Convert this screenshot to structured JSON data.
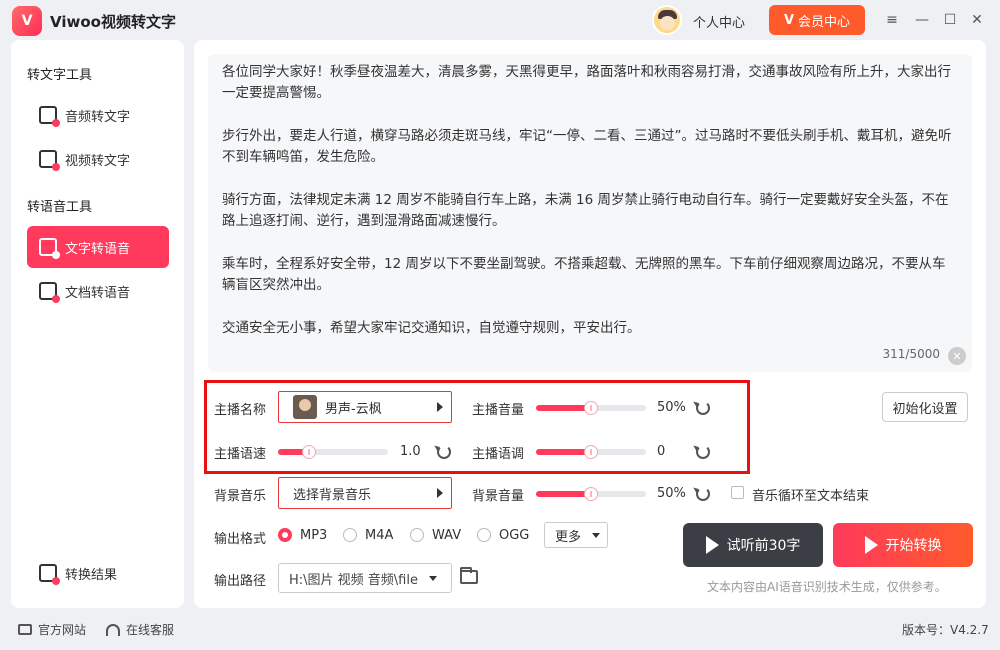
{
  "app": {
    "title": "Viwoo视频转文字",
    "logo_glyph": "V"
  },
  "header": {
    "personal_center": "个人中心",
    "vip_label": "会员中心",
    "vip_glyph": "V"
  },
  "window_controls": {
    "menu": "≡",
    "minimize": "—",
    "maximize": "☐",
    "close": "✕"
  },
  "sidebar": {
    "group1": "转文字工具",
    "group2": "转语音工具",
    "items": [
      {
        "label": "音频转文字",
        "icon": "audio-to-text-icon"
      },
      {
        "label": "视频转文字",
        "icon": "video-to-text-icon"
      },
      {
        "label": "文字转语音",
        "icon": "text-to-speech-icon",
        "active": true
      },
      {
        "label": "文档转语音",
        "icon": "document-to-speech-icon"
      }
    ],
    "results": "转换结果"
  },
  "editor": {
    "paragraphs": [
      "各位同学大家好！秋季昼夜温差大，清晨多雾，天黑得更早，路面落叶和秋雨容易打滑，交通事故风险有所上升，大家出行一定要提高警惕。",
      "步行外出，要走人行道，横穿马路必须走斑马线，牢记“一停、二看、三通过”。过马路时不要低头刷手机、戴耳机，避免听不到车辆鸣笛，发生危险。",
      "骑行方面，法律规定未满 12 周岁不能骑自行车上路，未满 16 周岁禁止骑行电动自行车。骑行一定要戴好安全头盔，不在路上追逐打闹、逆行，遇到湿滑路面减速慢行。",
      "乘车时，全程系好安全带，12 周岁以下不要坐副驾驶。不搭乘超载、无牌照的黑车。下车前仔细观察周边路况，不要从车辆盲区突然冲出。",
      "交通安全无小事，希望大家牢记交通知识，自觉遵守规则，平安出行。"
    ],
    "char_count": "311/5000",
    "clear_glyph": "✕"
  },
  "settings": {
    "anchor_name_label": "主播名称",
    "anchor_name_value": "男声-云枫",
    "anchor_volume_label": "主播音量",
    "anchor_volume_value": "50%",
    "anchor_volume_level": 0.5,
    "anchor_speed_label": "主播语速",
    "anchor_speed_value": "1.0",
    "anchor_speed_level": 0.28,
    "anchor_pitch_label": "主播语调",
    "anchor_pitch_value": "0",
    "anchor_pitch_level": 0.5,
    "init_button": "初始化设置",
    "bg_music_label": "背景音乐",
    "bg_music_value": "选择背景音乐",
    "bg_volume_label": "背景音量",
    "bg_volume_value": "50%",
    "bg_volume_level": 0.5,
    "loop_label": "音乐循环至文本结束",
    "format_label": "输出格式",
    "formats": [
      "MP3",
      "M4A",
      "WAV",
      "OGG"
    ],
    "selected_format": "MP3",
    "more_label": "更多",
    "path_label": "输出路径",
    "path_value": "H:\\图片 视频 音频\\file"
  },
  "actions": {
    "preview": "试听前30字",
    "start": "开始转换",
    "note": "文本内容由AI语音识别技术生成，仅供参考。"
  },
  "footer": {
    "website": "官方网站",
    "support": "在线客服",
    "version": "版本号：V4.2.7"
  },
  "colors": {
    "accent": "#ff3a5c",
    "vip": "#ff5a2c",
    "highlight": "#e81010",
    "dark_button": "#3b3e45"
  }
}
